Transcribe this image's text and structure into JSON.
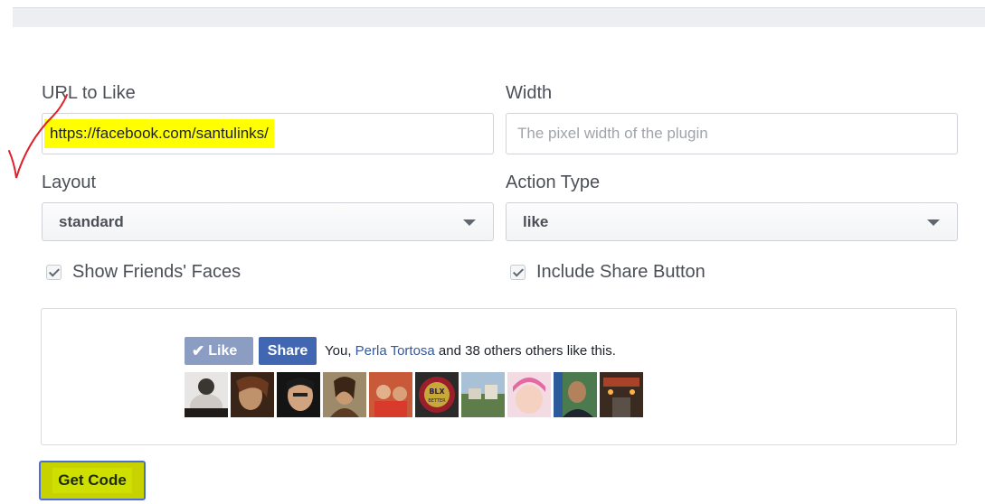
{
  "form": {
    "url_label": "URL to Like",
    "url_value": "https://facebook.com/santulinks/",
    "width_label": "Width",
    "width_placeholder": "The pixel width of the plugin",
    "layout_label": "Layout",
    "layout_value": "standard",
    "action_label": "Action Type",
    "action_value": "like",
    "show_faces_label": "Show Friends' Faces",
    "share_button_label": "Include Share Button",
    "show_faces_checked": true,
    "share_button_checked": true
  },
  "preview": {
    "like_label": "Like",
    "share_label": "Share",
    "social_prefix": "You, ",
    "social_name": "Perla Tortosa",
    "social_suffix": " and 38 others others like this.",
    "faces_count": 10
  },
  "actions": {
    "get_code_label": "Get Code"
  },
  "colors": {
    "like_button": "#8b9dc3",
    "share_button": "#4267b2",
    "highlight": "#ffff00",
    "annotation_mark": "#e0202a"
  }
}
